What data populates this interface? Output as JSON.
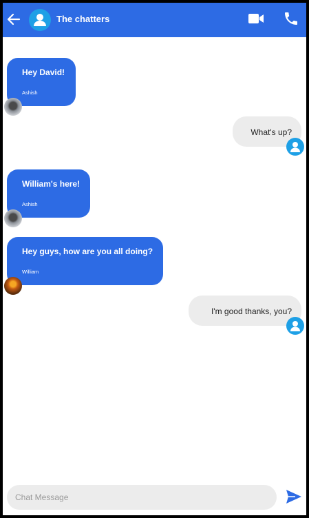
{
  "header": {
    "title": "The chatters",
    "back_icon": "arrow-left-icon",
    "avatar_icon": "user-icon",
    "video_icon": "video-camera-icon",
    "call_icon": "phone-icon"
  },
  "messages": [
    {
      "direction": "incoming",
      "text": "Hey David!",
      "sender": "Ashish",
      "avatar": "photo"
    },
    {
      "direction": "outgoing",
      "text": "What's up?",
      "avatar": "user-icon"
    },
    {
      "direction": "incoming",
      "text": "William's here!",
      "sender": "Ashish",
      "avatar": "photo"
    },
    {
      "direction": "incoming",
      "text": "Hey guys, how are you all doing?",
      "sender": "William",
      "avatar": "photo"
    },
    {
      "direction": "outgoing",
      "text": "I'm good thanks, you?",
      "avatar": "user-icon"
    }
  ],
  "composer": {
    "placeholder": "Chat Message",
    "value": "",
    "send_icon": "send-icon"
  },
  "colors": {
    "accent": "#2d6be4",
    "avatar_bg": "#1ea0e6",
    "outgoing_bubble": "#ececec"
  }
}
